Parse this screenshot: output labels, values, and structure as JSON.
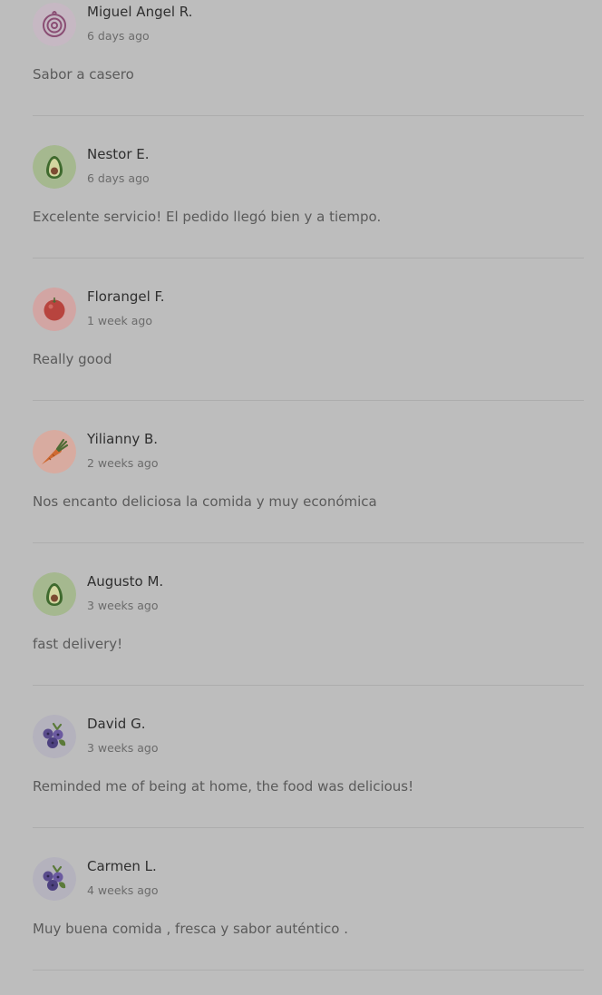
{
  "reviews": [
    {
      "name": "Miguel Angel R.",
      "time": "6 days ago",
      "text": "Sabor a casero",
      "avatar_icon": "onion-icon"
    },
    {
      "name": "Nestor E.",
      "time": "6 days ago",
      "text": "Excelente servicio! El pedido llegó bien y a tiempo.",
      "avatar_icon": "avocado-icon"
    },
    {
      "name": "Florangel F.",
      "time": "1 week ago",
      "text": "Really good",
      "avatar_icon": "tomato-icon"
    },
    {
      "name": "Yilianny B.",
      "time": "2 weeks ago",
      "text": "Nos encanto deliciosa la comida y muy económica",
      "avatar_icon": "carrot-icon"
    },
    {
      "name": "Augusto M.",
      "time": "3 weeks ago",
      "text": "fast delivery!",
      "avatar_icon": "avocado-icon"
    },
    {
      "name": "David G.",
      "time": "3 weeks ago",
      "text": "Reminded me of being at home, the food was delicious!",
      "avatar_icon": "blueberries-icon"
    },
    {
      "name": "Carmen L.",
      "time": "4 weeks ago",
      "text": "Muy buena comida , fresca y sabor auténtico .",
      "avatar_icon": "blueberries-icon"
    }
  ]
}
